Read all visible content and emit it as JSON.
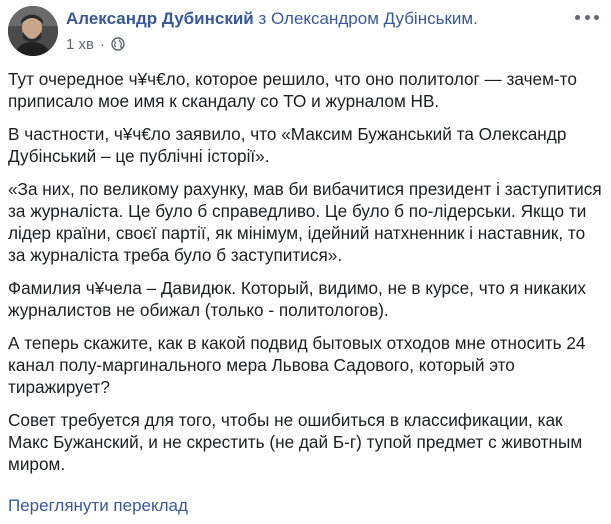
{
  "post": {
    "author": "Александр Дубинский",
    "with_word": "з",
    "tagged": "Олександром Дубінським.",
    "time": "1 хв",
    "dot": "·",
    "privacy_icon": "globe-icon",
    "more_icon": "more-options-icon",
    "paragraphs": [
      "Тут очередное ч¥ч€ло, которое решило, что оно политолог — зачем-то приписало мое имя к скандалу со ТО и журналом НВ.",
      "В частности, ч¥ч€ло заявило, что «Максим Бужанський та Олександр Дубінський – це публічні історії».",
      "«За них, по великому рахунку, мав би вибачитися президент і заступитися за журналіста. Це було б справедливо. Це було б по-лідерськи. Якщо ти лідер країни, своєї партії, як мінімум, ідейний натхненник і наставник, то за журналіста треба було б заступитися».",
      "Фамилия ч¥чела – Давидюк. Который, видимо, не в курсе, что я никаких журналистов не обижал (только - политологов).",
      "А теперь скажите, как в какой подвид бытовых отходов мне относить 24 канал полу-маргинального мера Львова Садового, который это тиражирует?",
      "Совет требуется для того, чтобы не ошибиться в классификации, как Макс Бужанский, и не скрестить (не дай Б-г) тупой предмет с животным миром."
    ],
    "translate_link": "Переглянути переклад"
  },
  "colors": {
    "link": "#385898",
    "text": "#1c1e21",
    "meta": "#606770"
  }
}
